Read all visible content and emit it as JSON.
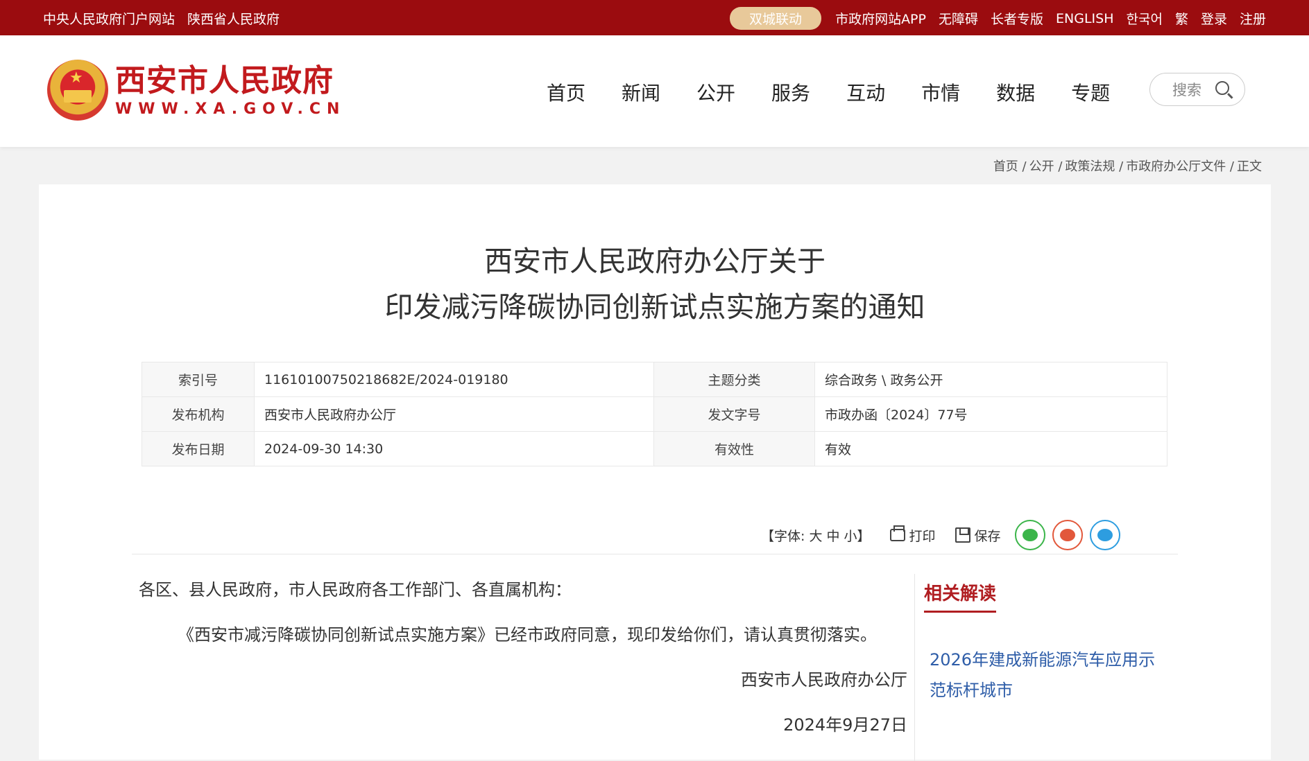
{
  "topbar": {
    "left_links": [
      "中央人民政府门户网站",
      "陕西省人民政府"
    ],
    "twin_city": "双城联动",
    "right_links": [
      "市政府网站APP",
      "无障碍",
      "长者专版",
      "ENGLISH",
      "한국어",
      "繁",
      "登录",
      "注册"
    ]
  },
  "header": {
    "logo_cn": "西安市人民政府",
    "logo_en": "WWW.XA.GOV.CN",
    "nav": [
      "首页",
      "新闻",
      "公开",
      "服务",
      "互动",
      "市情",
      "数据",
      "专题"
    ],
    "search_placeholder": "搜索"
  },
  "breadcrumb": [
    "首页 /",
    "公开 /",
    "政策法规 /",
    "市政府办公厅文件 /",
    "正文"
  ],
  "article": {
    "title_line1": "西安市人民政府办公厅关于",
    "title_line2": "印发减污降碳协同创新试点实施方案的通知",
    "meta": [
      {
        "k1": "索引号",
        "v1": "11610100750218682E/2024-019180",
        "k2": "主题分类",
        "v2": "综合政务 \\ 政务公开"
      },
      {
        "k1": "发布机构",
        "v1": "西安市人民政府办公厅",
        "k2": "发文字号",
        "v2": "市政办函〔2024〕77号"
      },
      {
        "k1": "发布日期",
        "v1": "2024-09-30 14:30",
        "k2": "有效性",
        "v2": "有效"
      }
    ],
    "tools": {
      "font_label": "【字体: 大 中 小】",
      "print": "打印",
      "save": "保存"
    },
    "greeting": "各区、县人民政府，市人民政府各工作部门、各直属机构：",
    "paragraph": "《西安市减污降碳协同创新试点实施方案》已经市政府同意，现印发给你们，请认真贯彻落实。",
    "signature": "西安市人民政府办公厅",
    "date": "2024年9月27日"
  },
  "related": {
    "heading": "相关解读",
    "link": "2026年建成新能源汽车应用示范标杆城市"
  },
  "colors": {
    "topbar": "#9b0c0f",
    "brand_red": "#c21a1d",
    "link_blue": "#2e5da8"
  }
}
